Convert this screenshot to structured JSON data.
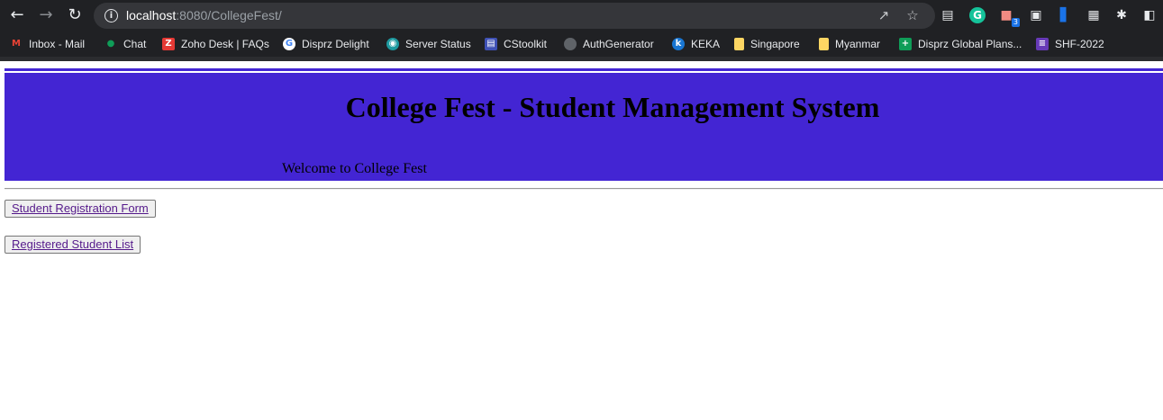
{
  "browser": {
    "url_host": "localhost",
    "url_rest": ":8080/CollegeFest/",
    "nav_icons": [
      "back-icon",
      "forward-icon",
      "reload-icon",
      "info-icon"
    ],
    "toolbar_icons": [
      "share-icon",
      "star-icon",
      "extension-icon",
      "grammarly-icon",
      "extension-icon",
      "extension-icon",
      "extension-icon",
      "qr-icon",
      "puzzle-icon",
      "sidebar-icon"
    ],
    "extension_badge": "3",
    "bookmarks": [
      {
        "label": "Inbox - Mail",
        "icon": "gmail-icon",
        "color": "#ea4335",
        "glyph": "M"
      },
      {
        "label": "Chat",
        "icon": "chat-icon",
        "color": "#0f9d58",
        "glyph": "●"
      },
      {
        "label": "Zoho Desk | FAQs",
        "icon": "zoho-icon",
        "color": "#e53935",
        "glyph": "Z"
      },
      {
        "label": "Disprz Delight",
        "icon": "google-icon",
        "color": "#ffffff",
        "glyph": "G"
      },
      {
        "label": "Server Status",
        "icon": "server-icon",
        "color": "#1e9aa0",
        "glyph": "◉"
      },
      {
        "label": "CStoolkit",
        "icon": "toolkit-icon",
        "color": "#3f51b5",
        "glyph": "▤"
      },
      {
        "label": "AuthGenerator",
        "icon": "globe-icon",
        "color": "#5f6368",
        "glyph": "●"
      },
      {
        "label": "KEKA",
        "icon": "keka-icon",
        "color": "#1976d2",
        "glyph": "k"
      },
      {
        "label": "Singapore",
        "icon": "folder-icon",
        "color": "#fdd663",
        "glyph": ""
      },
      {
        "label": "Myanmar",
        "icon": "folder-icon",
        "color": "#fdd663",
        "glyph": ""
      },
      {
        "label": "Disprz Global Plans...",
        "icon": "sheets-icon",
        "color": "#0f9d58",
        "glyph": "+"
      },
      {
        "label": "SHF-2022",
        "icon": "list-icon",
        "color": "#673ab7",
        "glyph": "≡"
      }
    ]
  },
  "page": {
    "title": "College Fest - Student Management System",
    "welcome": "Welcome to College Fest",
    "banner_color": "#4325d3",
    "buttons": [
      {
        "label": "Student Registration Form"
      },
      {
        "label": "Registered Student List"
      }
    ]
  }
}
